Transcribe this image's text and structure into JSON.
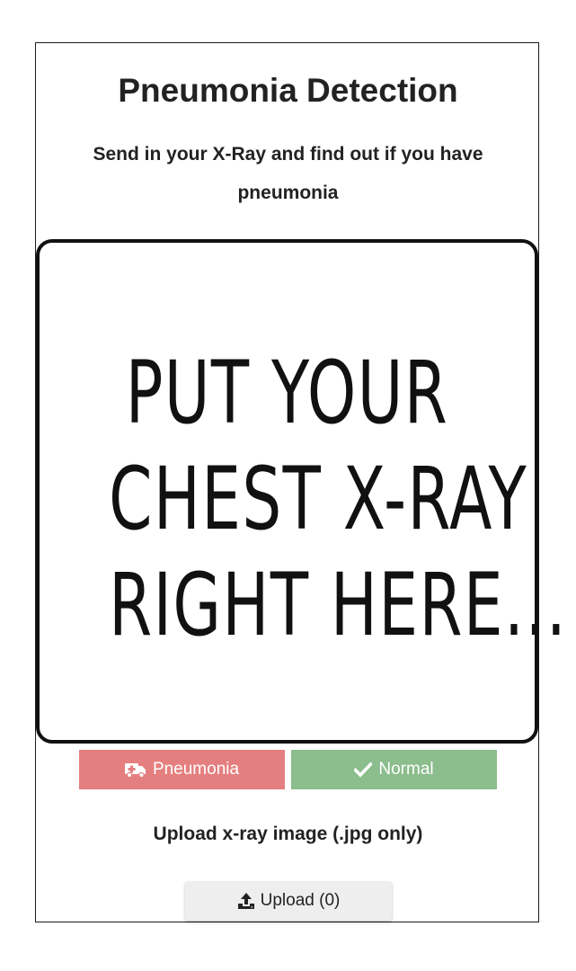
{
  "header": {
    "title": "Pneumonia Detection",
    "subtitle": "Send in your X-Ray and find out if you have pneumonia"
  },
  "dropzone": {
    "lines": [
      "PUT YOUR",
      "CHEST X-RAY",
      "RIGHT HERE..."
    ]
  },
  "results": {
    "pneumonia": {
      "label": "Pneumonia",
      "icon": "ambulance-icon",
      "color": "#e57f7f"
    },
    "normal": {
      "label": "Normal",
      "icon": "check-icon",
      "color": "#8bbd8d"
    }
  },
  "upload": {
    "instruction": "Upload x-ray image (.jpg only)",
    "button_label": "Upload (0)",
    "icon": "upload-icon"
  }
}
